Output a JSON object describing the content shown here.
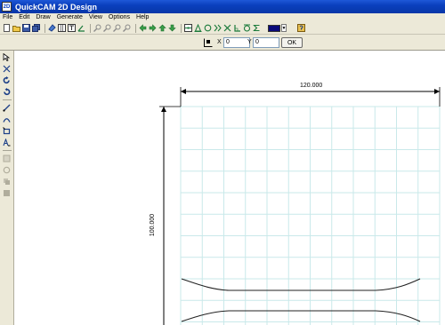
{
  "window": {
    "title": "QuickCAM 2D Design",
    "icon_text": "2D"
  },
  "menu": [
    "File",
    "Edit",
    "Draw",
    "Generate",
    "View",
    "Options",
    "Help"
  ],
  "toolbar": {
    "color_accent": "#0a0a7a",
    "file_icons": [
      "new-icon",
      "open-icon",
      "save-icon",
      "save-all-icon"
    ],
    "edit_icons": [
      "eraser-icon",
      "grid-icon",
      "text-page-icon",
      "angle-icon"
    ],
    "zoom_icons": [
      "zoom-in-icon",
      "zoom-pan-icon",
      "zoom-window-icon",
      "zoom-out-icon"
    ],
    "nav_icons": [
      "arrow-left-icon",
      "arrow-right-icon",
      "arrow-up-icon",
      "arrow-down-icon"
    ],
    "snap_icons": [
      "snap-endpoint-icon",
      "snap-tangent-icon",
      "snap-circle-icon",
      "snap-midpoint-icon",
      "snap-intersection-icon",
      "snap-perpendicular-icon",
      "snap-center-icon",
      "snap-sigma-icon"
    ]
  },
  "coords": {
    "x_label": "X",
    "x_value": "0",
    "y_label": "Y",
    "y_value": "0",
    "ok_label": "OK"
  },
  "left_tools": [
    "select-icon",
    "node-edit-icon",
    "rotate-icon",
    "undo-icon",
    "line-icon",
    "arc-icon",
    "rectangle-icon",
    "text-tool-icon",
    "grid-disabled-icon",
    "circle-disabled-icon",
    "copy-disabled-icon",
    "fill-disabled-icon"
  ],
  "drawing": {
    "width_dim": "120.000",
    "height_dim": "100.000",
    "grid_color": "#c9e9ea",
    "curve_color": "#222222"
  }
}
